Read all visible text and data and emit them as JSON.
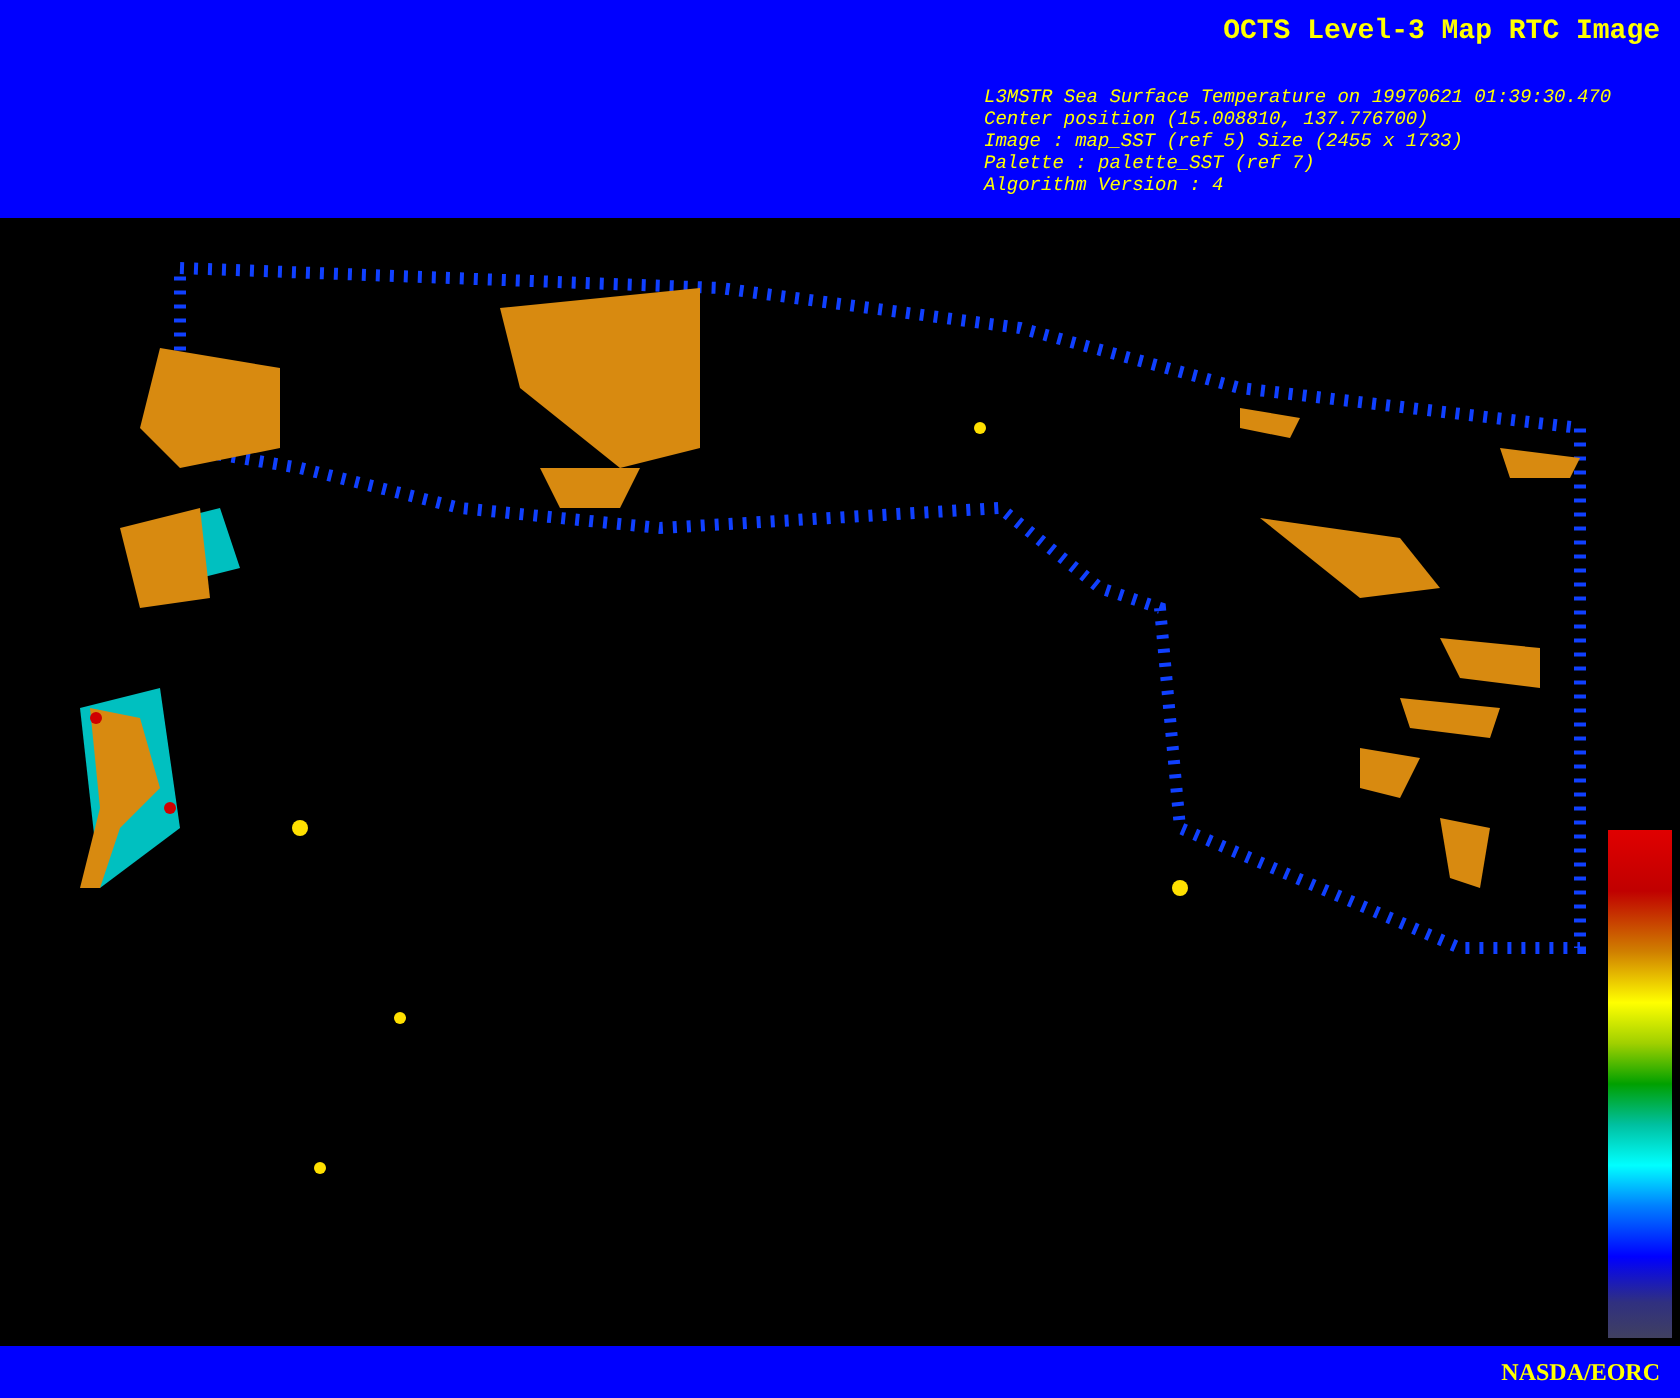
{
  "header": {
    "title": "OCTS Level-3 Map RTC Image",
    "info_lines": [
      "L3MSTR Sea Surface Temperature on 19970621 01:39:30.470",
      "Center position (15.008810, 137.776700)",
      "Image : map_SST (ref 5) Size (2455 x 1733)",
      "Palette : palette_SST (ref 7)",
      "Algorithm Version : 4"
    ]
  },
  "footer": {
    "credit": "NASDA/EORC"
  }
}
